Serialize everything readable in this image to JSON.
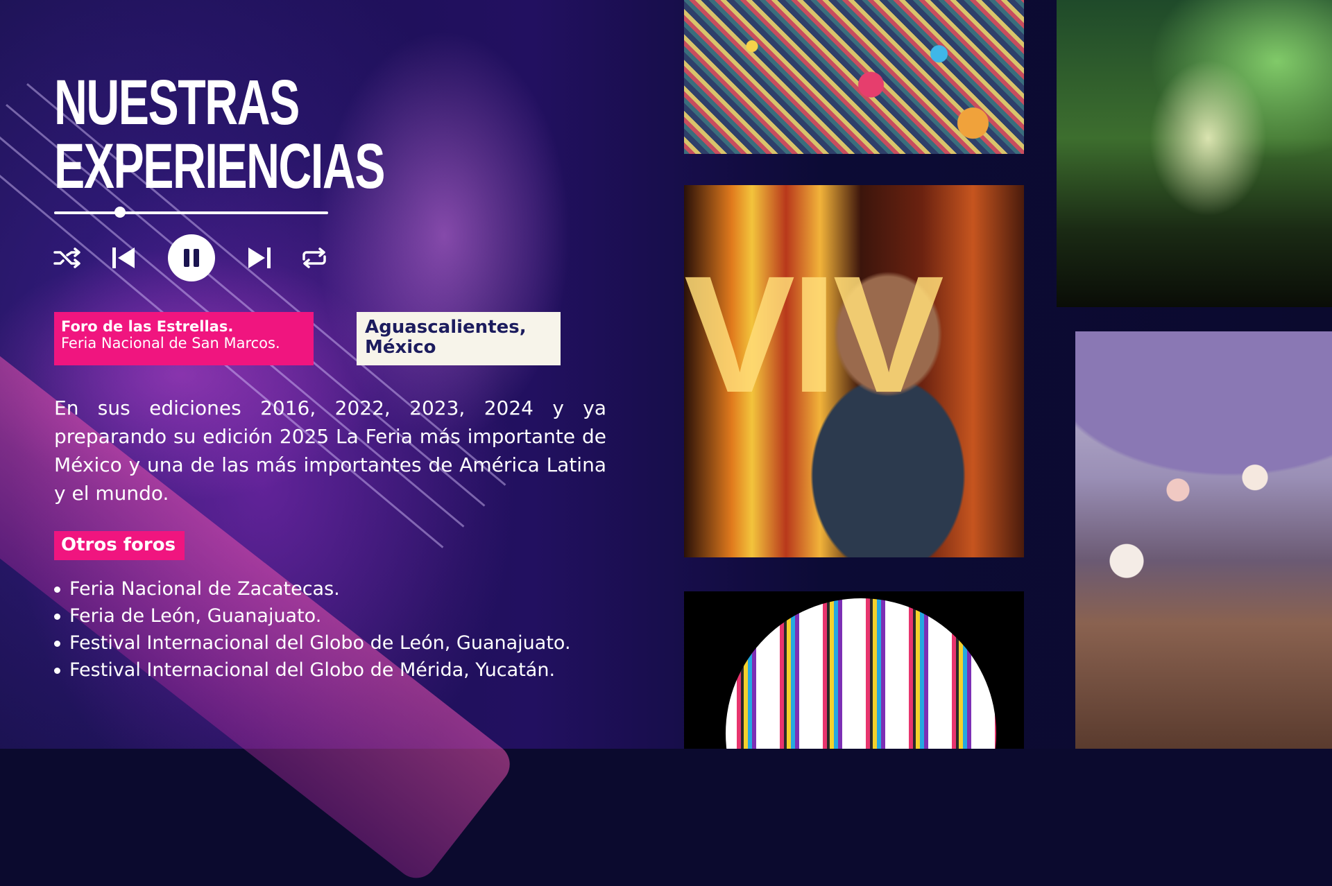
{
  "title": "NUESTRAS EXPERIENCIAS",
  "player": {
    "progress_fraction": 0.24,
    "controls": [
      "shuffle-icon",
      "previous-icon",
      "pause-icon",
      "next-icon",
      "repeat-icon"
    ],
    "state": "playing"
  },
  "venue": {
    "name": "Foro de las Estrellas.",
    "event": "Feria Nacional de San Marcos."
  },
  "location": "Aguascalientes, México",
  "description": "En sus ediciones 2016, 2022, 2023, 2024 y ya preparando su edición 2025 La Feria más importante de México y una de las más importantes de América Latina y el mundo.",
  "other_forums": {
    "heading": "Otros foros",
    "items": [
      "Feria Nacional de Zacatecas.",
      "Feria de León, Guanajuato.",
      "Festival Internacional del Globo de León, Guanajuato.",
      "Festival Internacional del Globo de Mérida, Yucatán."
    ]
  },
  "colors": {
    "accent_pink": "#f0157f",
    "cream": "#f7f4ea",
    "navy": "#0b0a2e",
    "text": "#ffffff"
  }
}
